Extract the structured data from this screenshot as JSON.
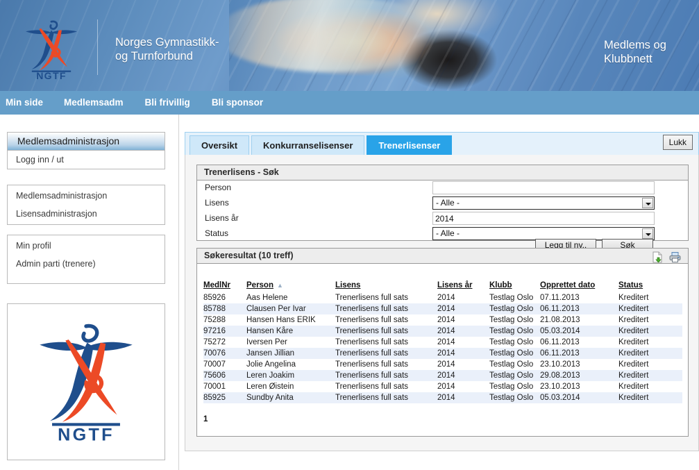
{
  "header": {
    "org_title": "Norges Gymnastikk-\nog Turnforbund",
    "portal_title": "Medlems og\nKlubbnett",
    "logo_text": "NGTF"
  },
  "nav": {
    "items": [
      {
        "label": "Min side"
      },
      {
        "label": "Medlemsadm"
      },
      {
        "label": "Bli frivillig"
      },
      {
        "label": "Bli sponsor"
      }
    ]
  },
  "sidebar": {
    "box1": {
      "header": "Medlemsadministrasjon",
      "links": [
        "Logg inn / ut"
      ]
    },
    "box2": {
      "links": [
        "Medlemsadministrasjon",
        "Lisensadministrasjon"
      ]
    },
    "box3": {
      "links": [
        "Min profil",
        "Admin parti (trenere)"
      ]
    },
    "logo_text": "NGTF"
  },
  "tabs": [
    {
      "label": "Oversikt",
      "active": false
    },
    {
      "label": "Konkurranselisenser",
      "active": false
    },
    {
      "label": "Trenerlisenser",
      "active": true
    }
  ],
  "close_button": "Lukk",
  "search": {
    "title": "Trenerlisens - Søk",
    "fields": {
      "person_label": "Person",
      "person_value": "",
      "person_placeholder": "",
      "lisens_label": "Lisens",
      "lisens_value": "- Alle -",
      "lisens_aar_label": "Lisens år",
      "lisens_aar_value": "2014",
      "status_label": "Status",
      "status_value": "- Alle -"
    },
    "add_button": "Legg til ny..",
    "search_button": "Søk"
  },
  "results": {
    "title": "Søkeresultat (10 treff)",
    "icons": {
      "export": "export-document-icon",
      "print": "printer-icon"
    },
    "columns": [
      "MedlNr",
      "Person",
      "Lisens",
      "Lisens år",
      "Klubb",
      "Opprettet dato",
      "Status"
    ],
    "sorted_column": "Person",
    "sort_direction": "asc",
    "rows": [
      {
        "medlnr": "85926",
        "person": "Aas Helene",
        "lisens": "Trenerlisens full sats",
        "ar": "2014",
        "klubb": "Testlag Oslo",
        "dato": "07.11.2013",
        "status": "Kreditert"
      },
      {
        "medlnr": "85788",
        "person": "Clausen Per Ivar",
        "lisens": "Trenerlisens full sats",
        "ar": "2014",
        "klubb": "Testlag Oslo",
        "dato": "06.11.2013",
        "status": "Kreditert"
      },
      {
        "medlnr": "75288",
        "person": "Hansen Hans ERIK",
        "lisens": "Trenerlisens full sats",
        "ar": "2014",
        "klubb": "Testlag Oslo",
        "dato": "21.08.2013",
        "status": "Kreditert"
      },
      {
        "medlnr": "97216",
        "person": "Hansen Kåre",
        "lisens": "Trenerlisens full sats",
        "ar": "2014",
        "klubb": "Testlag Oslo",
        "dato": "05.03.2014",
        "status": "Kreditert"
      },
      {
        "medlnr": "75272",
        "person": "Iversen Per",
        "lisens": "Trenerlisens full sats",
        "ar": "2014",
        "klubb": "Testlag Oslo",
        "dato": "06.11.2013",
        "status": "Kreditert"
      },
      {
        "medlnr": "70076",
        "person": "Jansen Jillian",
        "lisens": "Trenerlisens full sats",
        "ar": "2014",
        "klubb": "Testlag Oslo",
        "dato": "06.11.2013",
        "status": "Kreditert"
      },
      {
        "medlnr": "70007",
        "person": "Jolie Angelina",
        "lisens": "Trenerlisens full sats",
        "ar": "2014",
        "klubb": "Testlag Oslo",
        "dato": "23.10.2013",
        "status": "Kreditert"
      },
      {
        "medlnr": "75606",
        "person": "Leren Joakim",
        "lisens": "Trenerlisens full sats",
        "ar": "2014",
        "klubb": "Testlag Oslo",
        "dato": "29.08.2013",
        "status": "Kreditert"
      },
      {
        "medlnr": "70001",
        "person": "Leren Øistein",
        "lisens": "Trenerlisens full sats",
        "ar": "2014",
        "klubb": "Testlag Oslo",
        "dato": "23.10.2013",
        "status": "Kreditert"
      },
      {
        "medlnr": "85925",
        "person": "Sundby Anita",
        "lisens": "Trenerlisens full sats",
        "ar": "2014",
        "klubb": "Testlag Oslo",
        "dato": "05.03.2014",
        "status": "Kreditert"
      }
    ],
    "page_label": "1"
  },
  "colors": {
    "nav_bar": "#659ec9",
    "tab_active": "#29a3e8",
    "tab_inactive": "#cfe8f9",
    "logo_blue": "#1f4e8c",
    "logo_red": "#ec4a26",
    "row_alt": "#eaf0fa"
  }
}
